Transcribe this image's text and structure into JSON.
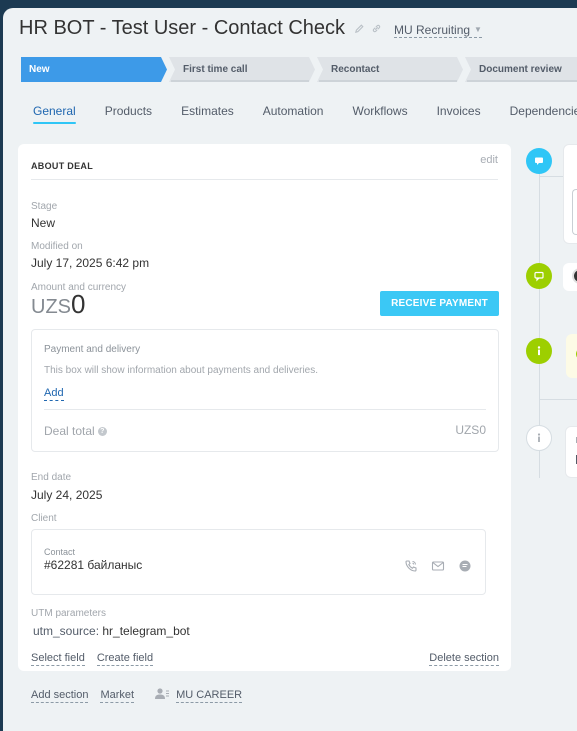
{
  "header": {
    "title": "HR BOT - Test User - Contact Check",
    "category": "MU Recruiting"
  },
  "stages": [
    {
      "label": "New",
      "color": "#3d9ae8",
      "active": true
    },
    {
      "label": "First time call",
      "color": "#dfe3e7",
      "active": false
    },
    {
      "label": "Recontact",
      "color": "#dfe3e7",
      "active": false
    },
    {
      "label": "Document review",
      "color": "#dfe3e7",
      "active": false
    }
  ],
  "tabs": [
    {
      "label": "General",
      "active": true
    },
    {
      "label": "Products"
    },
    {
      "label": "Estimates"
    },
    {
      "label": "Automation"
    },
    {
      "label": "Workflows"
    },
    {
      "label": "Invoices"
    },
    {
      "label": "Dependencies"
    }
  ],
  "about": {
    "title": "ABOUT DEAL",
    "edit": "edit",
    "stage_label": "Stage",
    "stage_value": "New",
    "modified_label": "Modified on",
    "modified_value": "July 17, 2025 6:42 pm",
    "amount_label": "Amount and currency",
    "amount_currency": "UZS",
    "amount_value": "0",
    "receive_payment": "RECEIVE PAYMENT",
    "payment": {
      "title": "Payment and delivery",
      "hint": "This box will show information about payments and deliveries.",
      "add": "Add",
      "total_label": "Deal total",
      "total_value": "UZS0"
    },
    "end_date_label": "End date",
    "end_date_value": "July 24, 2025",
    "client_label": "Client",
    "contact_label": "Contact",
    "contact_name": "#62281 байланыс",
    "utm_label": "UTM parameters",
    "utm_key": "utm_source:",
    "utm_value": "hr_telegram_bot",
    "select_field": "Select field",
    "create_field": "Create field",
    "delete_section": "Delete section"
  },
  "footer": {
    "add_section": "Add section",
    "market": "Market",
    "mu_career": "MU CAREER"
  },
  "timeline": {
    "colors": {
      "comment": "#2fc6f6",
      "chat": "#9dcf00",
      "info": "#9dcf00",
      "note": "#ffffff"
    },
    "icons": [
      "comment-icon",
      "chat-icon",
      "info-icon",
      "info-outline-icon"
    ]
  }
}
